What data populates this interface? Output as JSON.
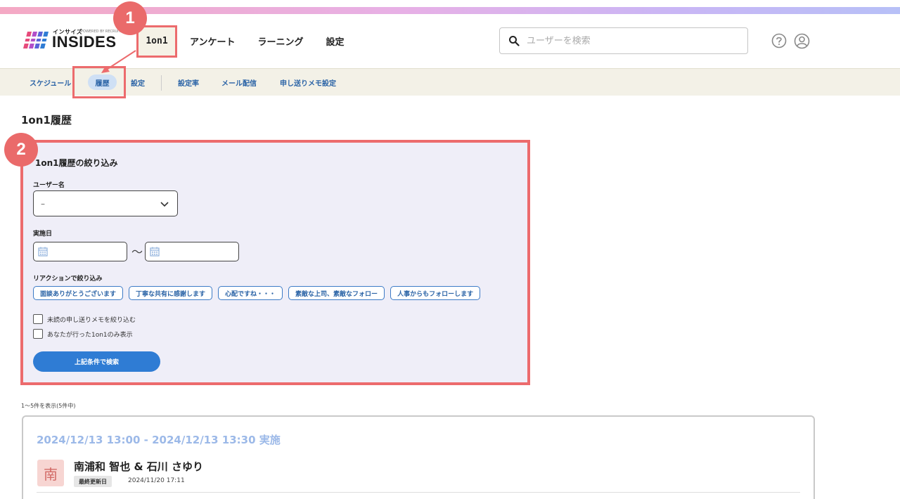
{
  "colors": {
    "accent": "#2f7cd4",
    "callout": "#ec6b6d",
    "panel_bg": "#efeef8",
    "subnav_bg": "#f3f1e7",
    "date_heading": "#9cb9e8"
  },
  "brand": {
    "kana": "インサイズ",
    "byline": "POWERED BY RECRUIT",
    "wordmark": "INSIDES"
  },
  "nav": {
    "items": [
      "1on1",
      "アンケート",
      "ラーニング",
      "設定"
    ]
  },
  "search": {
    "placeholder": "ユーザーを検索"
  },
  "header_icons": [
    "help-icon",
    "user-account-icon"
  ],
  "subnav": {
    "items": [
      "スケジュール",
      "履歴",
      "設定",
      "設定率",
      "メール配信",
      "申し送りメモ設定"
    ]
  },
  "callouts": [
    "1",
    "2"
  ],
  "page": {
    "title": "1on1履歴"
  },
  "filter": {
    "title": "1on1履歴の絞り込み",
    "user_label": "ユーザー名",
    "user_value": "–",
    "date_label": "実施日",
    "date_separator": "〜",
    "reaction_label": "リアクションで絞り込み",
    "reactions": [
      "面談ありがとうございます",
      "丁寧な共有に感謝します",
      "心配ですね・・・",
      "素敵な上司、素敵なフォロー",
      "人事からもフォローします"
    ],
    "checkboxes": [
      "未読の申し送りメモを絞り込む",
      "あなたが行った1on1のみ表示"
    ],
    "submit": "上記条件で検索"
  },
  "results": {
    "count_text": "1〜5件を表示(5件中)",
    "items": [
      {
        "when": "2024/12/13 13:00 - 2024/12/13 13:30 実施",
        "avatar": "南",
        "names": "南浦和 智也 & 石川 さゆり",
        "updated_label": "最終更新日",
        "updated_value": "2024/11/20 17:11"
      }
    ]
  }
}
